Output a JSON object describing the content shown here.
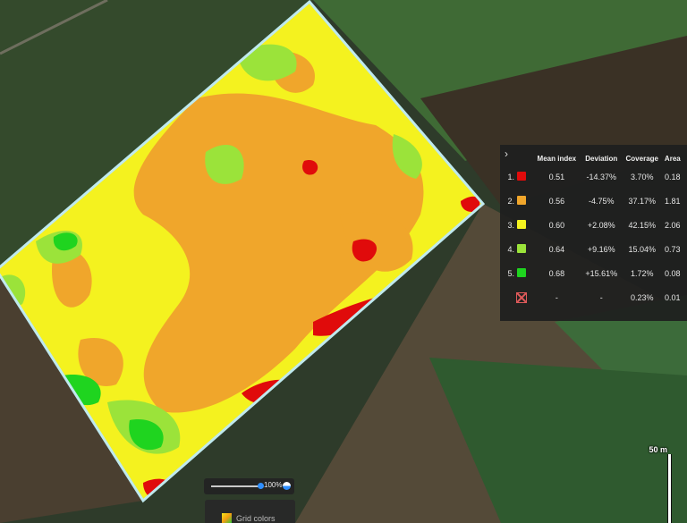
{
  "map": {
    "field_outline_color": "#bfe9ee",
    "background_colors": {
      "dark_field": "#2d3a28",
      "light_field": "#4b6a3a",
      "soil": "#5a4f3c"
    }
  },
  "legend": {
    "toggle_icon": "chevron-right-icon",
    "headers": {
      "index": "Mean index",
      "deviation": "Deviation",
      "coverage": "Coverage",
      "area": "Area"
    },
    "rows": [
      {
        "num": "1.",
        "color": "#e00b0b",
        "mean": "0.51",
        "deviation": "-14.37%",
        "coverage": "3.70%",
        "area": "0.18"
      },
      {
        "num": "2.",
        "color": "#f0a62b",
        "mean": "0.56",
        "deviation": "-4.75%",
        "coverage": "37.17%",
        "area": "1.81"
      },
      {
        "num": "3.",
        "color": "#f4f21f",
        "mean": "0.60",
        "deviation": "+2.08%",
        "coverage": "42.15%",
        "area": "2.06"
      },
      {
        "num": "4.",
        "color": "#9be33a",
        "mean": "0.64",
        "deviation": "+9.16%",
        "coverage": "15.04%",
        "area": "0.73"
      },
      {
        "num": "5.",
        "color": "#1fd41f",
        "mean": "0.68",
        "deviation": "+15.61%",
        "coverage": "1.72%",
        "area": "0.08"
      }
    ],
    "excluded": {
      "icon": "excluded-box-icon",
      "mean": "-",
      "deviation": "-",
      "coverage": "0.23%",
      "area": "0.01"
    }
  },
  "scale": {
    "label": "50 m"
  },
  "opacity": {
    "value_label": "100%",
    "value": 100,
    "icon": "opacity-drop-icon"
  },
  "grid_colors": {
    "label": "Grid colors",
    "icon": "color-gradient-icon"
  }
}
